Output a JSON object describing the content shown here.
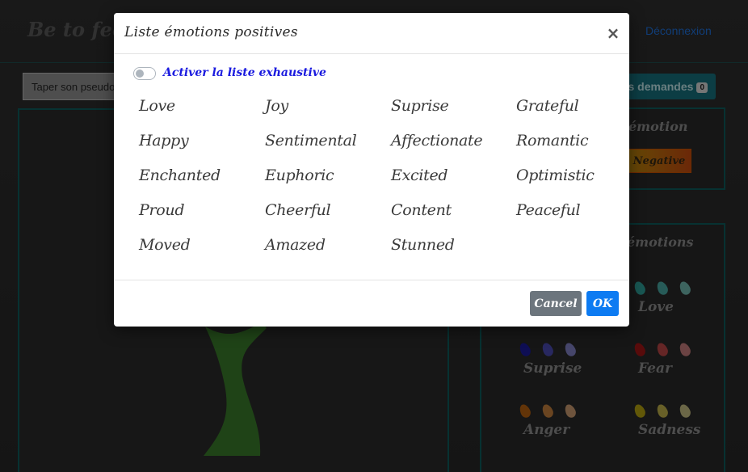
{
  "app": {
    "brand": "Be to feel",
    "logout_label": "Déconnexion",
    "pseudo_placeholder": "Taper son pseudo",
    "requests_label": "es demandes",
    "requests_count": "0",
    "filter_title": "émotion",
    "negative_label": "Negative",
    "emotions_title": "émotions",
    "leaf_groups": [
      {
        "label": "Love",
        "colors": [
          "#2f9e98",
          "#48a6a0",
          "#6fb6ae"
        ]
      },
      {
        "label": "Suprise",
        "colors": [
          "#1a1a99",
          "#4a4ab0",
          "#8080c4"
        ]
      },
      {
        "label": "Fear",
        "colors": [
          "#a01515",
          "#b84545",
          "#c47a7a"
        ]
      },
      {
        "label": "Anger",
        "colors": [
          "#b36010",
          "#c27e3c",
          "#c99a70"
        ]
      },
      {
        "label": "Sadness",
        "colors": [
          "#b3a010",
          "#bdb04a",
          "#c4bc82"
        ]
      }
    ]
  },
  "modal": {
    "title": "Liste émotions positives",
    "close_symbol": "×",
    "toggle_label": "Activer la liste exhaustive",
    "emotions": [
      "Love",
      "Joy",
      "Suprise",
      "Grateful",
      "Happy",
      "Sentimental",
      "Affectionate",
      "Romantic",
      "Enchanted",
      "Euphoric",
      "Excited",
      "Optimistic",
      "Proud",
      "Cheerful",
      "Content",
      "Peaceful",
      "Moved",
      "Amazed",
      "Stunned"
    ],
    "cancel_label": "Cancel",
    "ok_label": "OK"
  },
  "colors": {
    "accent": "#0d7bf2",
    "cancel": "#6c757d",
    "toggle_label": "#1a1adf",
    "panel_border": "#0d5b5b"
  }
}
